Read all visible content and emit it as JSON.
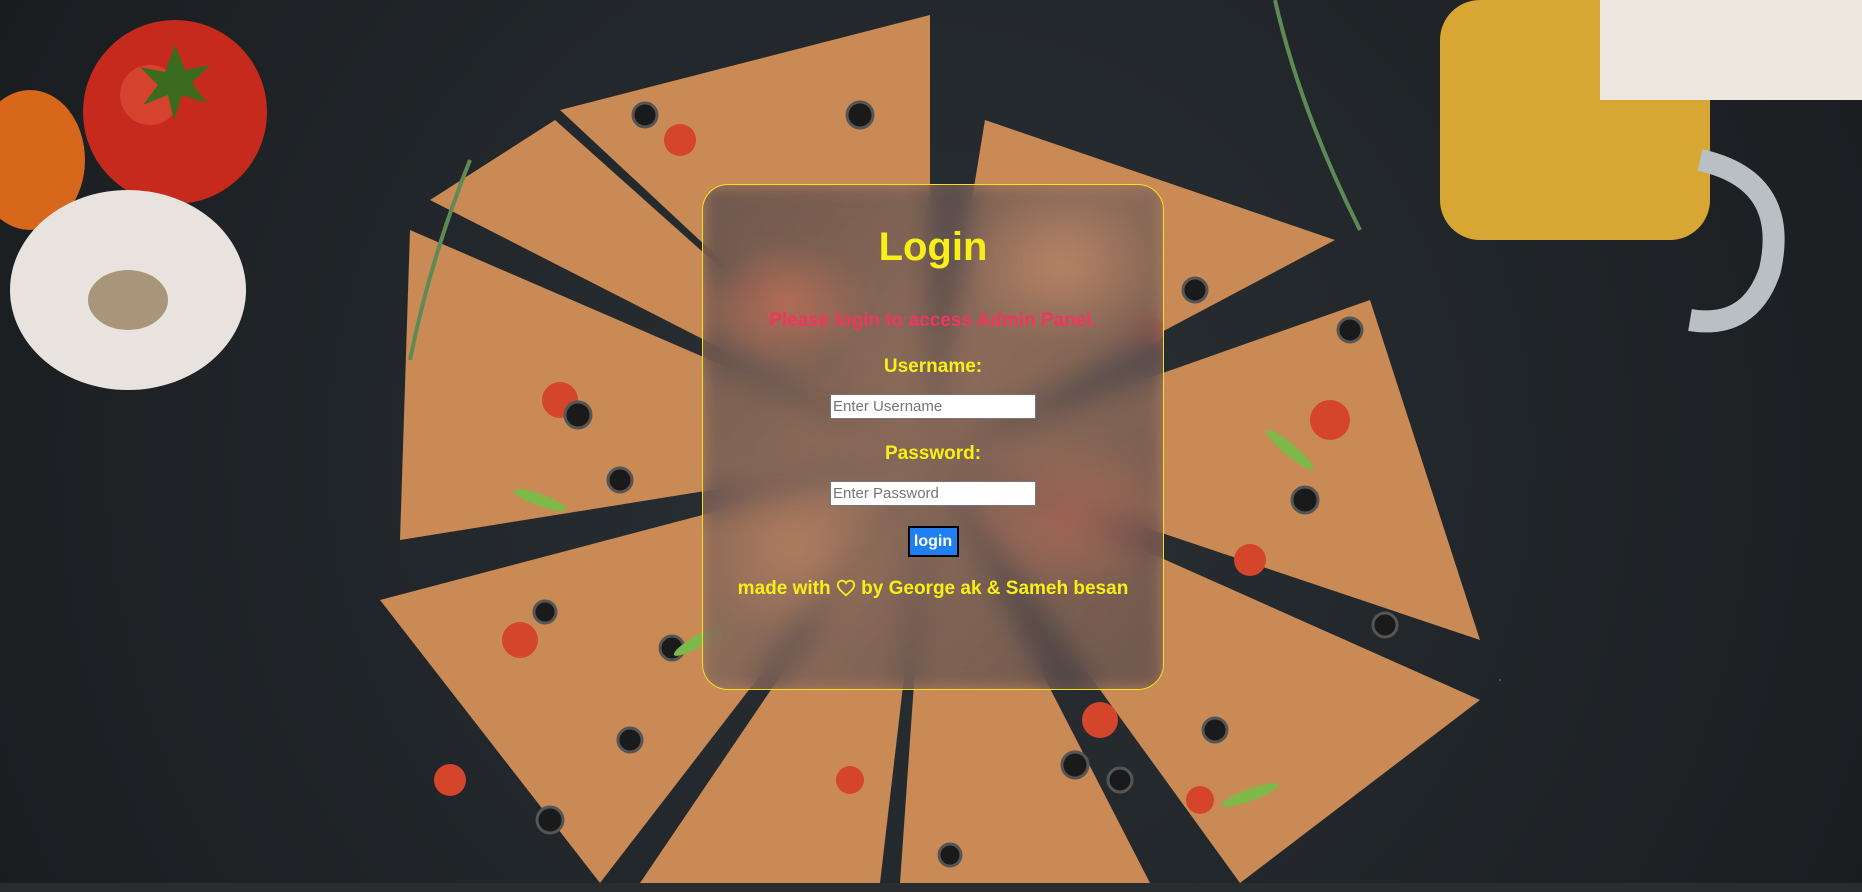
{
  "login_card": {
    "title": "Login",
    "subtitle": "Please login to access Admin Panel.",
    "username": {
      "label": "Username:",
      "placeholder": "Enter Username",
      "value": ""
    },
    "password": {
      "label": "Password:",
      "placeholder": "Enter Password",
      "value": ""
    },
    "login_button_label": "login",
    "footer": {
      "prefix": "made with",
      "icon": "heart-icon",
      "suffix": "by George ak & Sameh besan"
    }
  },
  "colors": {
    "accent_yellow": "#f8ef18",
    "subtitle_red": "#f0365e",
    "button_blue": "#1f7ff0",
    "card_border": "#f2e21a"
  },
  "background": {
    "description_icons": [
      "pizza-image",
      "tomato-image",
      "garlic-image",
      "pepper-image",
      "rosemary-image",
      "beer-mug-image"
    ]
  }
}
